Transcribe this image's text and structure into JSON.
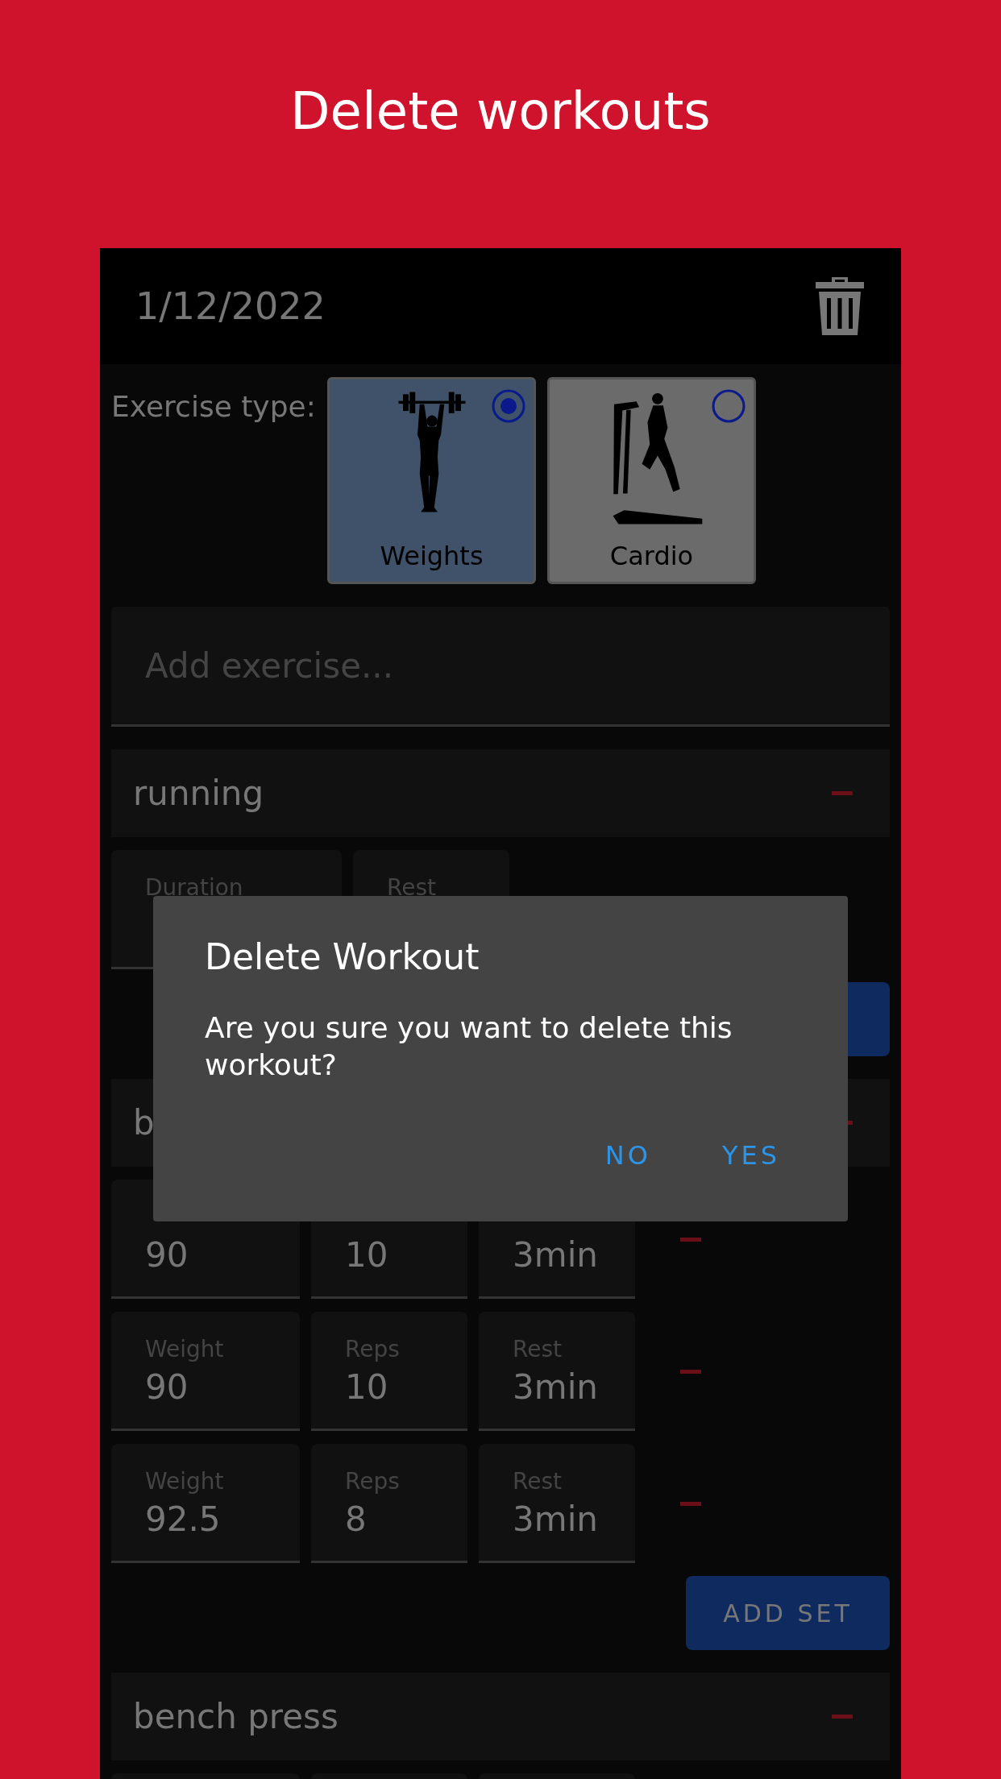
{
  "page_title": "Delete workouts",
  "workout": {
    "date": "1/12/2022",
    "exercise_type_label": "Exercise type:",
    "exercise_types": [
      {
        "label": "Weights",
        "kind": "weights",
        "selected": true
      },
      {
        "label": "Cardio",
        "kind": "cardio",
        "selected": false
      }
    ],
    "add_exercise": {
      "placeholder": "Add exercise..."
    },
    "exercises": [
      {
        "name": "running",
        "fields": [
          {
            "label": "Duration"
          },
          {
            "label": "Rest"
          }
        ],
        "add_set_button": true
      },
      {
        "name": "b",
        "sets": [
          {
            "fields": [
              {
                "value": "90"
              },
              {
                "value": "10"
              },
              {
                "value": "3min"
              }
            ]
          },
          {
            "fields": [
              {
                "label": "Weight",
                "value": "90"
              },
              {
                "label": "Reps",
                "value": "10"
              },
              {
                "label": "Rest",
                "value": "3min"
              }
            ]
          },
          {
            "fields": [
              {
                "label": "Weight",
                "value": "92.5"
              },
              {
                "label": "Reps",
                "value": "8"
              },
              {
                "label": "Rest",
                "value": "3min"
              }
            ]
          }
        ],
        "add_set_label": "ADD SET"
      },
      {
        "name": "bench press",
        "more_rows_below": true
      }
    ]
  },
  "dialog": {
    "title": "Delete Workout",
    "message": "Are you sure you want to delete this workout?",
    "buttons": [
      "NO",
      "YES"
    ]
  }
}
